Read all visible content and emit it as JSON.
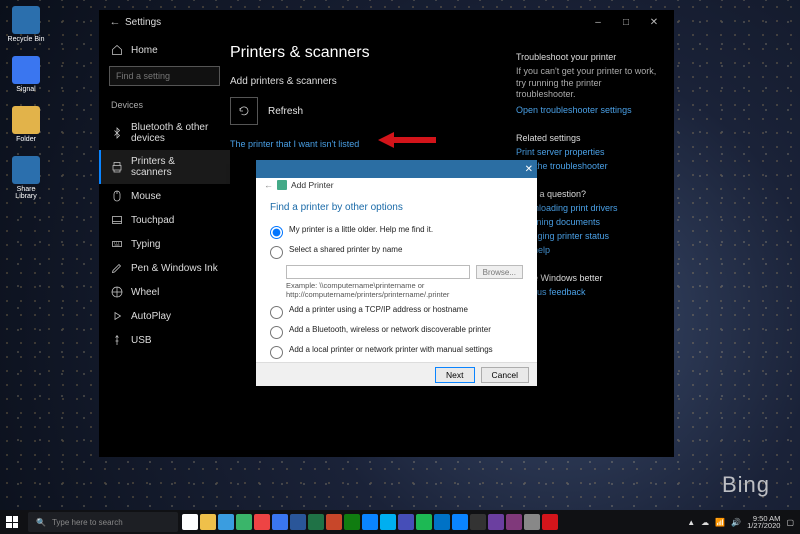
{
  "desktop": {
    "icons": [
      {
        "label": "Recycle Bin",
        "color": "#2b6fad"
      },
      {
        "label": "Signal",
        "color": "#3a76f0"
      },
      {
        "label": "Folder",
        "color": "#e2b34a"
      },
      {
        "label": "Share Library",
        "color": "#2b6fad"
      }
    ],
    "bing_logo": "Bing"
  },
  "settings": {
    "window_title": "Settings",
    "home_label": "Home",
    "search_placeholder": "Find a setting",
    "section_header": "Devices",
    "sidebar_items": [
      {
        "icon": "bluetooth",
        "label": "Bluetooth & other devices"
      },
      {
        "icon": "printer",
        "label": "Printers & scanners"
      },
      {
        "icon": "mouse",
        "label": "Mouse"
      },
      {
        "icon": "touchpad",
        "label": "Touchpad"
      },
      {
        "icon": "typing",
        "label": "Typing"
      },
      {
        "icon": "pen",
        "label": "Pen & Windows Ink"
      },
      {
        "icon": "wheel",
        "label": "Wheel"
      },
      {
        "icon": "autoplay",
        "label": "AutoPlay"
      },
      {
        "icon": "usb",
        "label": "USB"
      }
    ],
    "active_index": 1,
    "page_title": "Printers & scanners",
    "subsection": "Add printers & scanners",
    "refresh_label": "Refresh",
    "not_listed_link": "The printer that I want isn't listed",
    "right": {
      "troubleshoot_head": "Troubleshoot your printer",
      "troubleshoot_body": "If you can't get your printer to work, try running the printer troubleshooter.",
      "open_troubleshooter": "Open troubleshooter settings",
      "related_head": "Related settings",
      "print_server": "Print server properties",
      "run_troubleshooter": "Run the troubleshooter",
      "question_head": "Have a question?",
      "links": [
        "Downloading print drivers",
        "Scanning documents",
        "Changing printer status",
        "Get help"
      ],
      "better_head": "Make Windows better",
      "feedback": "Give us feedback"
    }
  },
  "dialog": {
    "breadcrumb": "Add Printer",
    "title": "Find a printer by other options",
    "options": [
      "My printer is a little older. Help me find it.",
      "Select a shared printer by name",
      "Add a printer using a TCP/IP address or hostname",
      "Add a Bluetooth, wireless or network discoverable printer",
      "Add a local printer or network printer with manual settings"
    ],
    "selected_index": 0,
    "browse_label": "Browse...",
    "example_line1": "Example: \\\\computername\\printername or",
    "example_line2": "http://computername/printers/printername/.printer",
    "next": "Next",
    "cancel": "Cancel"
  },
  "taskbar": {
    "search_placeholder": "Type here to search",
    "icons": [
      "task-view",
      "file-explorer",
      "store",
      "edge",
      "chrome",
      "mail",
      "word",
      "excel",
      "powerpoint",
      "xbox",
      "cortana",
      "skype",
      "teams",
      "spotify",
      "outlook",
      "onedrive",
      "terminal",
      "whiteboard",
      "onenote",
      "settings",
      "snip"
    ],
    "icon_colors": [
      "#ffffff",
      "#efc04a",
      "#3a9de0",
      "#3ab56a",
      "#e44",
      "#3a76f0",
      "#2a5699",
      "#1f7246",
      "#c8472a",
      "#107c10",
      "#0a84ff",
      "#00aff0",
      "#464eb8",
      "#1db954",
      "#0072c6",
      "#0a84ff",
      "#333",
      "#6b3fa0",
      "#80397b",
      "#888",
      "#d4151b"
    ],
    "tray": {
      "net": "wifi",
      "vol": "sound",
      "time": "9:50 AM",
      "date": "1/27/2020"
    }
  }
}
